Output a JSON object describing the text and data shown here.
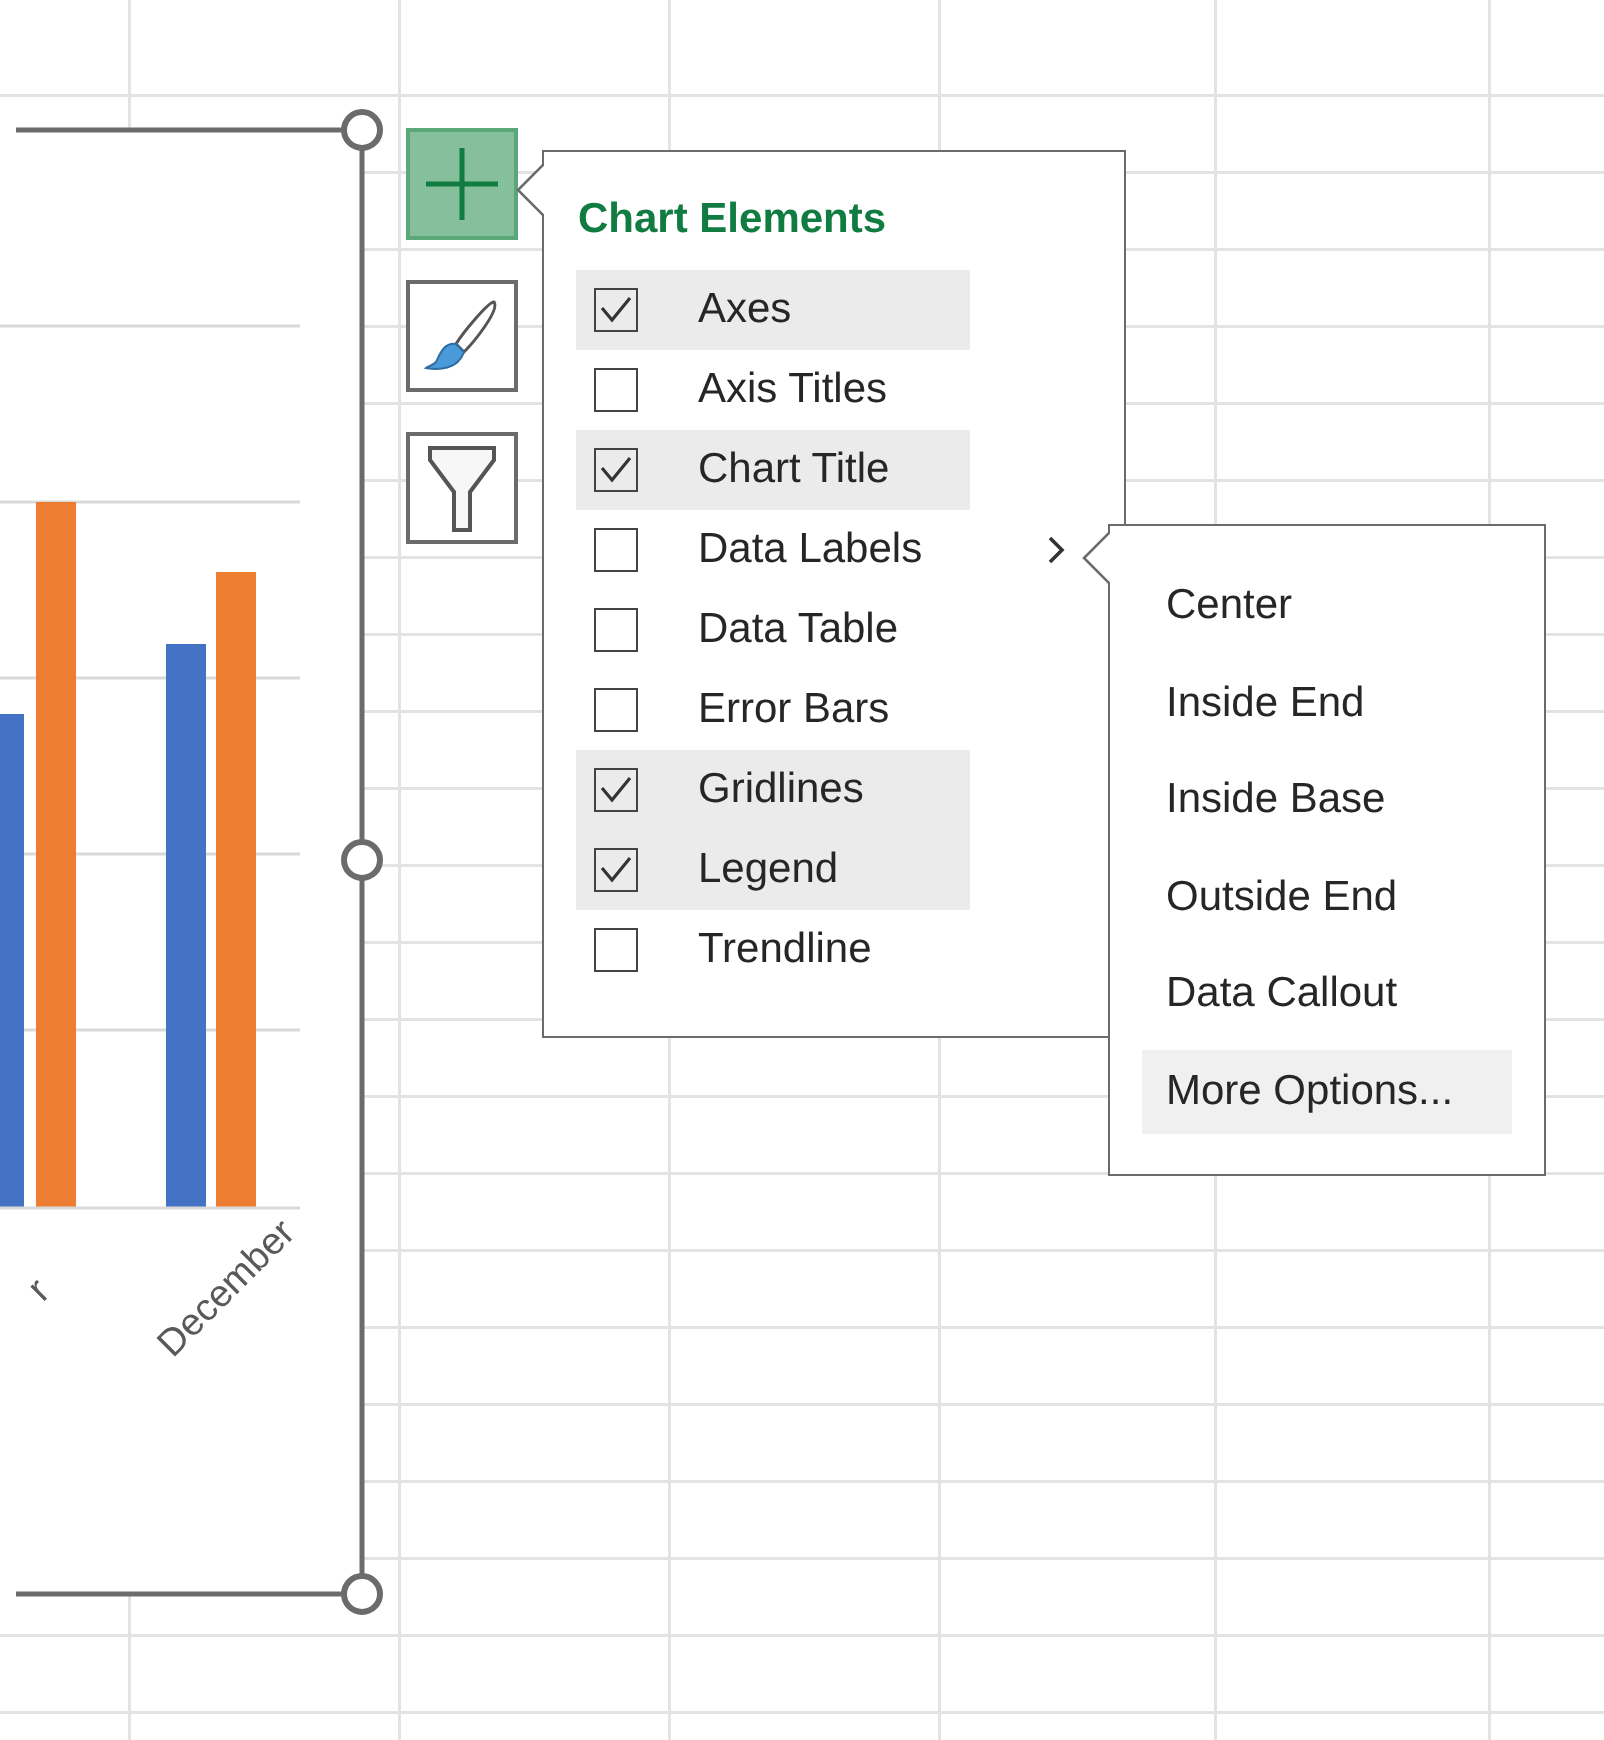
{
  "chart": {
    "x_labels": [
      "r",
      "December"
    ]
  },
  "tools": [
    {
      "kind": "elements",
      "selected": true
    },
    {
      "kind": "styles",
      "selected": false
    },
    {
      "kind": "filter",
      "selected": false
    }
  ],
  "chart_elements": {
    "title": "Chart Elements",
    "items": [
      {
        "label": "Axes",
        "checked": true
      },
      {
        "label": "Axis Titles",
        "checked": false
      },
      {
        "label": "Chart Title",
        "checked": true
      },
      {
        "label": "Data Labels",
        "checked": false,
        "submenu": true
      },
      {
        "label": "Data Table",
        "checked": false
      },
      {
        "label": "Error Bars",
        "checked": false
      },
      {
        "label": "Gridlines",
        "checked": true
      },
      {
        "label": "Legend",
        "checked": true
      },
      {
        "label": "Trendline",
        "checked": false
      }
    ]
  },
  "submenu": {
    "items": [
      {
        "label": "Center",
        "selected": false
      },
      {
        "label": "Inside End",
        "selected": false
      },
      {
        "label": "Inside Base",
        "selected": false
      },
      {
        "label": "Outside End",
        "selected": false
      },
      {
        "label": "Data Callout",
        "selected": false
      },
      {
        "label": "More Options...",
        "selected": true
      }
    ]
  }
}
